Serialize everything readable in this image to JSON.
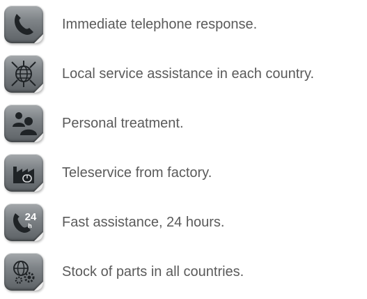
{
  "features": [
    {
      "icon": "telephone-icon",
      "text": "Immediate telephone response."
    },
    {
      "icon": "globe-network-icon",
      "text": "Local service assistance in each country."
    },
    {
      "icon": "people-icon",
      "text": "Personal treatment."
    },
    {
      "icon": "factory-icon",
      "text": "Teleservice from factory."
    },
    {
      "icon": "phone-24h-icon",
      "text": "Fast assistance, 24 hours."
    },
    {
      "icon": "globe-gears-icon",
      "text": "Stock of parts in all countries."
    }
  ],
  "icon_badge": {
    "number": "24",
    "unit": "h"
  },
  "colors": {
    "text": "#5a5a5a",
    "icon_bg": "#7f8488",
    "glyph": "#1f2326"
  }
}
